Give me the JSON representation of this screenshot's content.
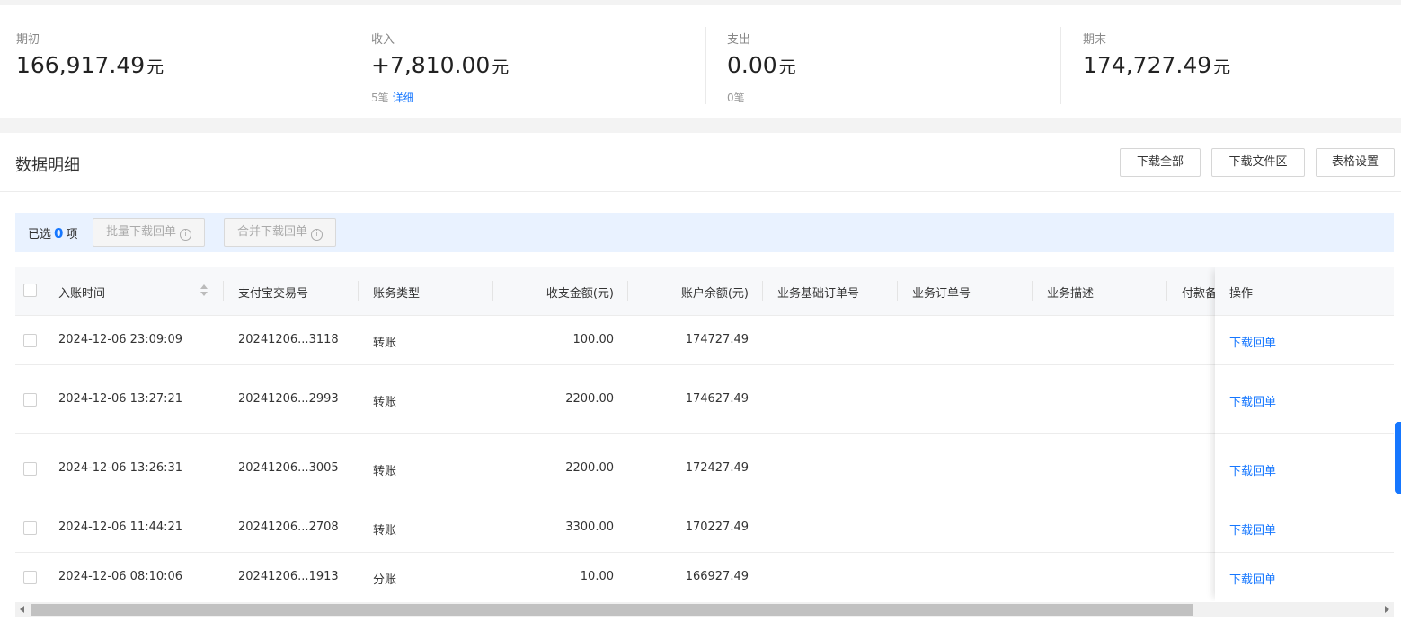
{
  "summary": {
    "opening": {
      "label": "期初",
      "amount": "166,917.49",
      "unit": "元"
    },
    "income": {
      "label": "收入",
      "amount": "+7,810.00",
      "unit": "元",
      "count": "5笔",
      "detail_link": "详细"
    },
    "expense": {
      "label": "支出",
      "amount": "0.00",
      "unit": "元",
      "count": "0笔"
    },
    "closing": {
      "label": "期末",
      "amount": "174,727.49",
      "unit": "元"
    }
  },
  "section": {
    "title": "数据明细",
    "buttons": {
      "download_all": "下载全部",
      "download_files": "下载文件区",
      "table_settings": "表格设置"
    }
  },
  "selection": {
    "prefix": "已选",
    "count": "0",
    "suffix": "项",
    "batch_download": "批量下载回单",
    "merge_download": "合并下载回单"
  },
  "table": {
    "columns": {
      "time": "入账时间",
      "trade_no": "支付宝交易号",
      "type": "账务类型",
      "amount": "收支金额(元)",
      "balance": "账户余额(元)",
      "base_order": "业务基础订单号",
      "order": "业务订单号",
      "desc": "业务描述",
      "remark": "付款备",
      "action": "操作"
    },
    "rows": [
      {
        "time": "2024-12-06 23:09:09",
        "trade_no": "20241206...3118",
        "type": "转账",
        "amount": "100.00",
        "balance": "174727.49",
        "action": "下载回单"
      },
      {
        "time": "2024-12-06 13:27:21",
        "trade_no": "20241206...2993",
        "type": "转账",
        "amount": "2200.00",
        "balance": "174627.49",
        "action": "下载回单"
      },
      {
        "time": "2024-12-06 13:26:31",
        "trade_no": "20241206...3005",
        "type": "转账",
        "amount": "2200.00",
        "balance": "172427.49",
        "action": "下载回单"
      },
      {
        "time": "2024-12-06 11:44:21",
        "trade_no": "20241206...2708",
        "type": "转账",
        "amount": "3300.00",
        "balance": "170227.49",
        "action": "下载回单"
      },
      {
        "time": "2024-12-06 08:10:06",
        "trade_no": "20241206...1913",
        "type": "分账",
        "amount": "10.00",
        "balance": "166927.49",
        "action": "下载回单"
      }
    ]
  },
  "colors": {
    "accent": "#1677ff",
    "selection_bg": "#e9f2ff"
  }
}
